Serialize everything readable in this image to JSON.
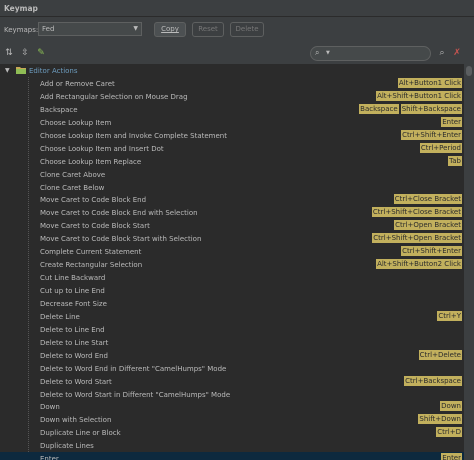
{
  "window": {
    "title": "Keymap"
  },
  "keymap": {
    "label": "Keymaps:",
    "selected": "Fed",
    "copy_label": "Copy",
    "reset_label": "Reset",
    "delete_label": "Delete"
  },
  "tree": {
    "group_label": "Editor Actions",
    "rows": [
      {
        "name": "Add or Remove Caret",
        "shortcuts": [
          "Alt+Button1 Click"
        ]
      },
      {
        "name": "Add Rectangular Selection on Mouse Drag",
        "shortcuts": [
          "Alt+Shift+Button1 Click"
        ]
      },
      {
        "name": "Backspace",
        "shortcuts": [
          "Backspace",
          "Shift+Backspace"
        ]
      },
      {
        "name": "Choose Lookup Item",
        "shortcuts": [
          "Enter"
        ]
      },
      {
        "name": "Choose Lookup Item and Invoke Complete Statement",
        "shortcuts": [
          "Ctrl+Shift+Enter"
        ]
      },
      {
        "name": "Choose Lookup Item and Insert Dot",
        "shortcuts": [
          "Ctrl+Period"
        ]
      },
      {
        "name": "Choose Lookup Item Replace",
        "shortcuts": [
          "Tab"
        ]
      },
      {
        "name": "Clone Caret Above",
        "shortcuts": []
      },
      {
        "name": "Clone Caret Below",
        "shortcuts": []
      },
      {
        "name": "Move Caret to Code Block End",
        "shortcuts": [
          "Ctrl+Close Bracket"
        ]
      },
      {
        "name": "Move Caret to Code Block End with Selection",
        "shortcuts": [
          "Ctrl+Shift+Close Bracket"
        ]
      },
      {
        "name": "Move Caret to Code Block Start",
        "shortcuts": [
          "Ctrl+Open Bracket"
        ]
      },
      {
        "name": "Move Caret to Code Block Start with Selection",
        "shortcuts": [
          "Ctrl+Shift+Open Bracket"
        ]
      },
      {
        "name": "Complete Current Statement",
        "shortcuts": [
          "Ctrl+Shift+Enter"
        ]
      },
      {
        "name": "Create Rectangular Selection",
        "shortcuts": [
          "Alt+Shift+Button2 Click"
        ]
      },
      {
        "name": "Cut Line Backward",
        "shortcuts": []
      },
      {
        "name": "Cut up to Line End",
        "shortcuts": []
      },
      {
        "name": "Decrease Font Size",
        "shortcuts": []
      },
      {
        "name": "Delete Line",
        "shortcuts": [
          "Ctrl+Y"
        ]
      },
      {
        "name": "Delete to Line End",
        "shortcuts": []
      },
      {
        "name": "Delete to Line Start",
        "shortcuts": []
      },
      {
        "name": "Delete to Word End",
        "shortcuts": [
          "Ctrl+Delete"
        ]
      },
      {
        "name": "Delete to Word End in Different \"CamelHumps\" Mode",
        "shortcuts": []
      },
      {
        "name": "Delete to Word Start",
        "shortcuts": [
          "Ctrl+Backspace"
        ]
      },
      {
        "name": "Delete to Word Start in Different \"CamelHumps\" Mode",
        "shortcuts": []
      },
      {
        "name": "Down",
        "shortcuts": [
          "Down"
        ]
      },
      {
        "name": "Down with Selection",
        "shortcuts": [
          "Shift+Down"
        ]
      },
      {
        "name": "Duplicate Line or Block",
        "shortcuts": [
          "Ctrl+D"
        ]
      },
      {
        "name": "Duplicate Lines",
        "shortcuts": []
      },
      {
        "name": "Enter",
        "shortcuts": [
          "Enter"
        ],
        "selected": true
      }
    ]
  },
  "colors": {
    "accent_link": "#6d9cbe",
    "shortcut_bg": "#c2b05d",
    "panel_bg": "#3c3f41",
    "tree_bg": "#2b2b2b"
  }
}
